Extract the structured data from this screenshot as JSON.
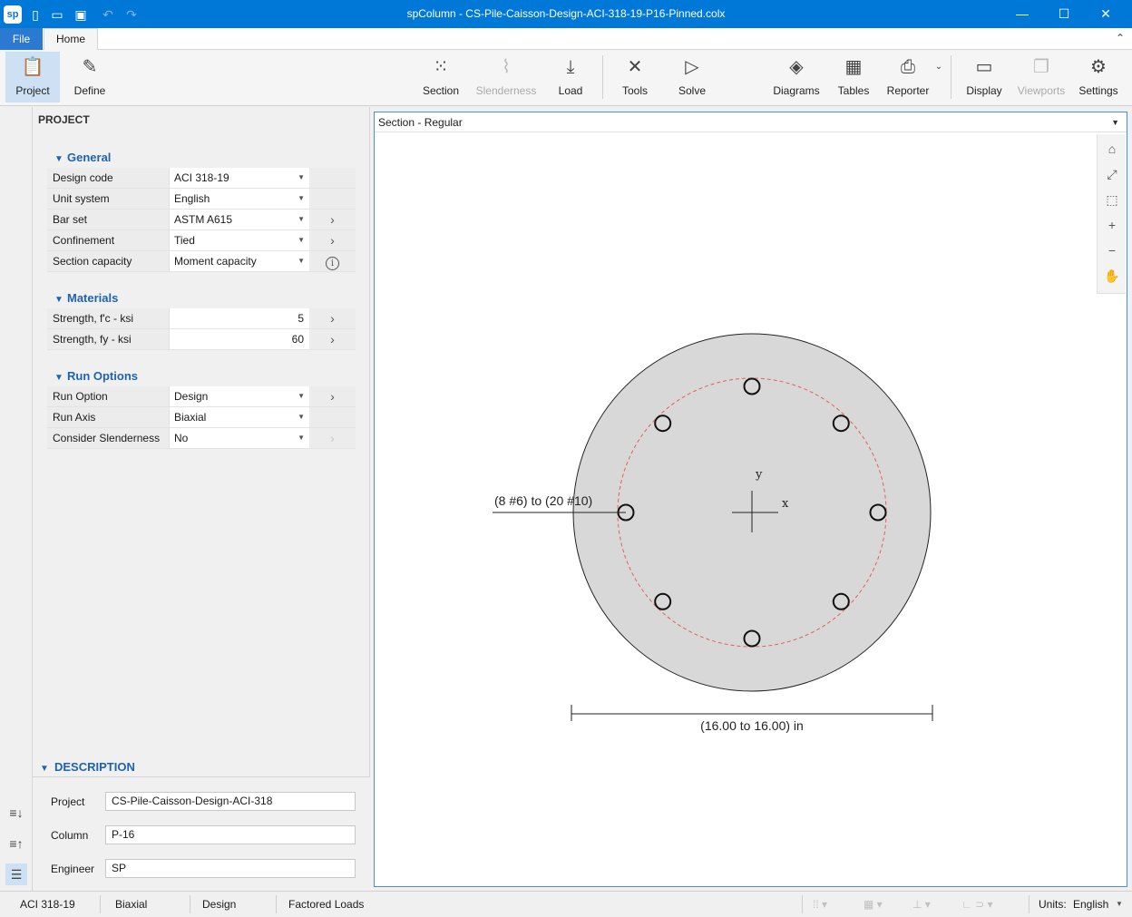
{
  "window": {
    "title": "spColumn - CS-Pile-Caisson-Design-ACI-318-19-P16-Pinned.colx",
    "logo": "sp",
    "quick_access": [
      "new-file-icon",
      "open-folder-icon",
      "save-icon",
      "undo-icon",
      "redo-icon"
    ],
    "controls": {
      "minimize": "—",
      "maximize": "☐",
      "close": "✕"
    }
  },
  "ribbon_tabs": {
    "file": "File",
    "home": "Home"
  },
  "ribbon": {
    "project": "Project",
    "define": "Define",
    "section": "Section",
    "slenderness": "Slenderness",
    "load": "Load",
    "tools": "Tools",
    "solve": "Solve",
    "diagrams": "Diagrams",
    "tables": "Tables",
    "reporter": "Reporter",
    "display": "Display",
    "viewports": "Viewports",
    "settings": "Settings"
  },
  "panel": {
    "title": "PROJECT",
    "general": {
      "header": "General",
      "rows": [
        {
          "label": "Design code",
          "value": "ACI 318-19"
        },
        {
          "label": "Unit system",
          "value": "English"
        },
        {
          "label": "Bar set",
          "value": "ASTM A615"
        },
        {
          "label": "Confinement",
          "value": "Tied"
        },
        {
          "label": "Section capacity",
          "value": "Moment capacity"
        }
      ]
    },
    "materials": {
      "header": "Materials",
      "rows": [
        {
          "label": "Strength, f'c - ksi",
          "value": "5"
        },
        {
          "label": "Strength, fy  - ksi",
          "value": "60"
        }
      ]
    },
    "run_options": {
      "header": "Run Options",
      "rows": [
        {
          "label": "Run Option",
          "value": "Design"
        },
        {
          "label": "Run Axis",
          "value": "Biaxial"
        },
        {
          "label": "Consider Slenderness",
          "value": "No"
        }
      ]
    },
    "info_glyph": "i",
    "description": {
      "header": "DESCRIPTION",
      "project_label": "Project",
      "project_value": "CS-Pile-Caisson-Design-ACI-318",
      "column_label": "Column",
      "column_value": "P-16",
      "engineer_label": "Engineer",
      "engineer_value": "SP"
    }
  },
  "canvas": {
    "view_title": "Section - Regular",
    "bar_label": "(8 #6) to (20 #10)",
    "dimension_label": "(16.00 to 16.00) in",
    "axis_x": "x",
    "axis_y": "y",
    "bar_count": 8
  },
  "status": {
    "code": "ACI 318-19",
    "axis": "Biaxial",
    "option": "Design",
    "loads": "Factored Loads",
    "units_label": "Units:",
    "units_value": "English"
  },
  "colors": {
    "accent": "#0078d7",
    "section_fill": "#d8d8d8",
    "tie_line": "#e06060"
  }
}
